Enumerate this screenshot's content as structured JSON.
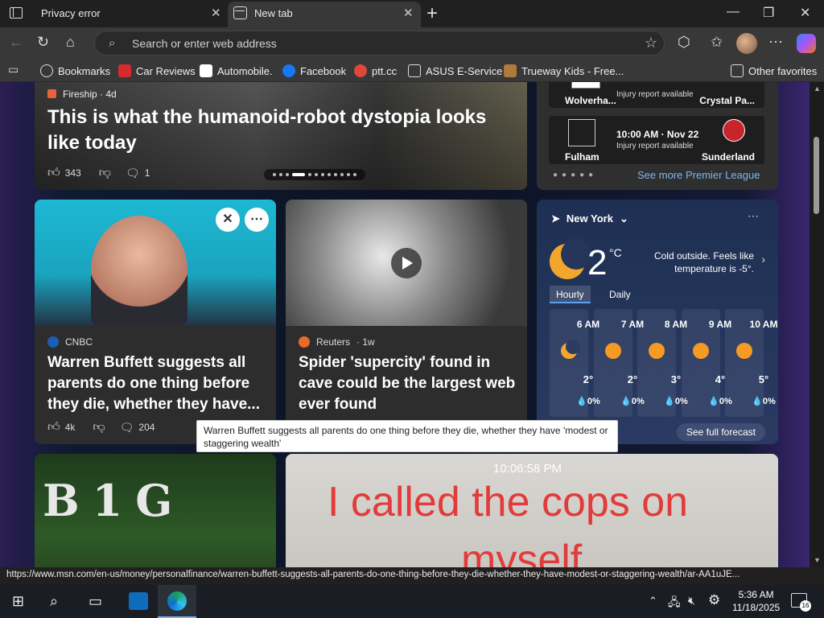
{
  "tabs": [
    {
      "title": "Privacy error"
    },
    {
      "title": "New tab"
    }
  ],
  "address_bar": {
    "placeholder": "Search or enter web address"
  },
  "bookmarks": [
    {
      "label": "Bookmarks",
      "color": "#ffffff"
    },
    {
      "label": "Car Reviews",
      "color": "#d62b2b"
    },
    {
      "label": "Automobile.",
      "color": "#ffffff"
    },
    {
      "label": "Facebook",
      "color": "#1877f2"
    },
    {
      "label": "ptt.cc",
      "color": "#e0473b"
    },
    {
      "label": "ASUS E-Service",
      "color": "#cccccc"
    },
    {
      "label": "Trueway Kids - Free...",
      "color": "#b07a3b"
    }
  ],
  "other_favorites": "Other favorites",
  "hero": {
    "source": "Fireship",
    "age": "· 4d",
    "headline": "This is what the humanoid-robot dystopia looks like today",
    "likes": "343",
    "comments": "1"
  },
  "sports": {
    "matches": [
      {
        "home": "Wolverha...",
        "away": "Crystal Pa...",
        "time": "",
        "note": "Injury report available"
      },
      {
        "home": "Fulham",
        "away": "Sunderland",
        "time": "10:00 AM · Nov 22",
        "note": "Injury report available"
      }
    ],
    "more_link": "See more Premier League"
  },
  "news": [
    {
      "source": "CNBC",
      "age": "",
      "headline": "Warren Buffett suggests all parents do one thing before they die, whether they have...",
      "likes": "4k",
      "comments": "204",
      "logo_color": "#1a5fb4"
    },
    {
      "source": "Reuters",
      "age": "· 1w",
      "headline": "Spider 'supercity' found in cave could be the largest web ever found",
      "likes": "",
      "comments": "",
      "logo_color": "#e86b2a"
    }
  ],
  "weather": {
    "location": "New York",
    "temperature": "2",
    "unit": "°C",
    "description": "Cold outside. Feels like temperature is -5°.",
    "tabs": [
      "Hourly",
      "Daily"
    ],
    "hours": [
      {
        "time": "6 AM",
        "temp": "2°",
        "precip": "💧0%",
        "icon": "moon-icon"
      },
      {
        "time": "7 AM",
        "temp": "2°",
        "precip": "💧0%",
        "icon": "sun-icon"
      },
      {
        "time": "8 AM",
        "temp": "3°",
        "precip": "💧0%",
        "icon": "sun-icon"
      },
      {
        "time": "9 AM",
        "temp": "4°",
        "precip": "💧0%",
        "icon": "sun-icon"
      },
      {
        "time": "10 AM",
        "temp": "5°",
        "precip": "💧0%",
        "icon": "sun-icon"
      }
    ],
    "full_forecast": "See full forecast"
  },
  "tooltip": "Warren Buffett suggests all parents do one thing before they die, whether they have 'modest or staggering wealth'",
  "bottom_cards": {
    "big_text": "B1G",
    "video_time": "10:06:58 PM",
    "video_caption_1": "I called the cops on",
    "video_caption_2": "myself"
  },
  "status_url": "https://www.msn.com/en-us/money/personalfinance/warren-buffett-suggests-all-parents-do-one-thing-before-they-die-whether-they-have-modest-or-staggering-wealth/ar-AA1uJE...",
  "taskbar": {
    "time": "5:36 AM",
    "date": "11/18/2025",
    "notifications": "16"
  }
}
